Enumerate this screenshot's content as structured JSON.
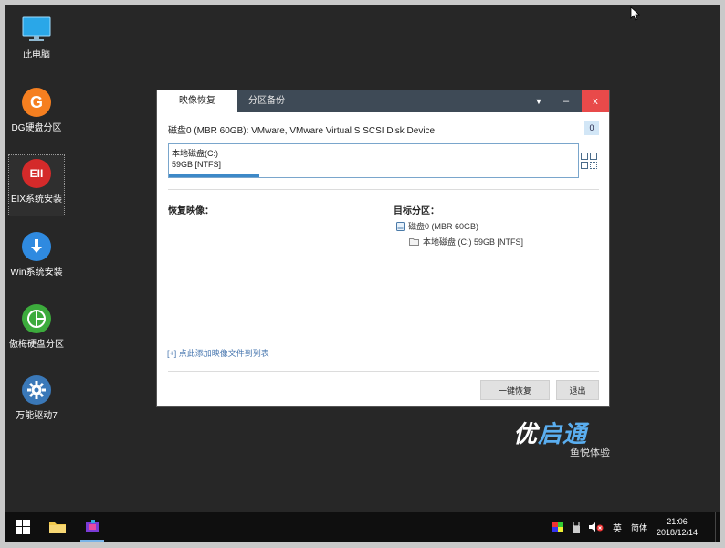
{
  "desktop": {
    "icons": [
      {
        "label": "此电脑",
        "icon": "computer-icon"
      },
      {
        "label": "DG硬盘分区",
        "icon": "diskgenius-icon",
        "glyph": "G",
        "color": "#f57f20"
      },
      {
        "label": "EIX系统安装",
        "icon": "eix-icon",
        "glyph": "EII",
        "color": "#d42a2a"
      },
      {
        "label": "Win系统安装",
        "icon": "download-arrow-icon",
        "color": "#2f8ae0"
      },
      {
        "label": "傲梅硬盘分区",
        "icon": "aomei-icon",
        "color": "#3cab3c"
      },
      {
        "label": "万能驱动7",
        "icon": "gear-icon",
        "color": "#3a78b8"
      }
    ]
  },
  "dialog": {
    "tabs": [
      "映像恢复",
      "分区备份"
    ],
    "disk_title": "磁盘0 (MBR 60GB): VMware, VMware Virtual S SCSI Disk Device",
    "disk_index": "0",
    "partition": {
      "name": "本地磁盘(C:)",
      "size": "59GB [NTFS]",
      "usage": 0.22
    },
    "restore_image_label": "恢复映像：",
    "target_partition_label": "目标分区：",
    "tree": {
      "disk": "磁盘0 (MBR 60GB)",
      "partition": "本地磁盘 (C:) 59GB [NTFS]"
    },
    "add_image_link": "[+] 点此添加映像文件到列表",
    "buttons": {
      "restore": "一键恢复",
      "exit": "退出"
    },
    "controls": {
      "menu": "▼",
      "minimize": "–",
      "close": "x"
    }
  },
  "brand": {
    "logo_part1": "优",
    "logo_part2": "启通",
    "subtitle": "鱼悦体验"
  },
  "taskbar": {
    "ime_lang": "英",
    "ime_mode": "简体",
    "time": "21:06",
    "date": "2018/12/14"
  },
  "colors": {
    "desktop_bg": "#272727",
    "titlebar": "#3e4a56",
    "close": "#e84a4a",
    "accent": "#3d89c8"
  }
}
